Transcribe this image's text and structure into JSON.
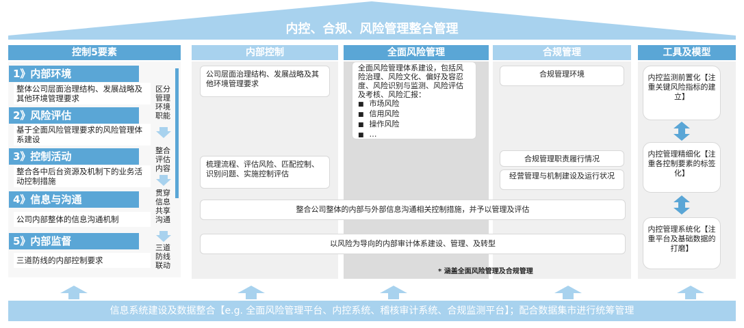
{
  "title": "内控、合规、风险管理整合管理",
  "columns": {
    "elements": "控制5要素",
    "internal": "内部控制",
    "risk": "全面风险管理",
    "compliance": "合规管理",
    "tools": "工具及模型"
  },
  "elements": [
    {
      "head": "1》内部环境",
      "body": "整体公司层面治理结构、发展战略及其他环境管理要求"
    },
    {
      "head": "2》风险评估",
      "body": "基于全面风险管理要求的风险管理体系建设"
    },
    {
      "head": "3》控制活动",
      "body": "整合各中后台资源及机制下的业务活动控制措施"
    },
    {
      "head": "4》信息与沟通",
      "body": "公司内部整体的信息沟通机制"
    },
    {
      "head": "5》内部监督",
      "body": "三道防线的内部控制要求"
    }
  ],
  "side_labels": [
    "区分管理环境职能",
    "整合评估内容",
    "贯穿信息共享沟通",
    "三道防线联动"
  ],
  "internal": {
    "box1": "公司层面治理结构、发展战略及其他环境管理要求",
    "box2": "梳理流程、评估风险、匹配控制、识别问题、实施控制评估"
  },
  "risk": {
    "intro": "全面风险管理体系建设，包括风险治理、风险文化、偏好及容忍度、风险识别与监测、风险评估及考核、风险汇报：",
    "items": [
      "市场风险",
      "信用风险",
      "操作风险",
      "…"
    ]
  },
  "compliance": {
    "box1": "合规管理环境",
    "box2": "合规管理职责履行情况",
    "box3": "经营管理与机制建设及运行状况"
  },
  "wide_boxes": [
    "整合公司整体的内部与外部信息沟通相关控制措施，并予以管理及评估",
    "以风险为导向的内部审计体系建设、管理、及转型"
  ],
  "note": "* 涵盖全面风险管理及合规管理",
  "tools": [
    "内控监测前置化【注重关键风险指标的建立】",
    "内控管理精细化【注重各控制要素的标签化】",
    "内控管理系统化【注重平台及基础数据的打磨】"
  ],
  "footer": "信息系统建设及数据整合【e.g. 全面风险管理平台、内控系统、稽核审计系统、合规监测平台】；配合数据集市进行统筹管理",
  "colors": {
    "accent": "#5aa6d6",
    "light": "#a8d2ee",
    "panel": "#f0f0f0"
  }
}
